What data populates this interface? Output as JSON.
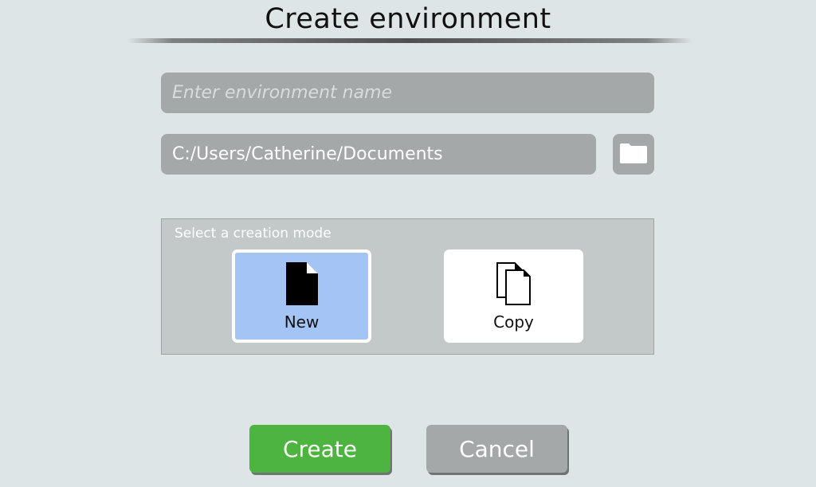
{
  "dialog": {
    "title": "Create environment"
  },
  "name_field": {
    "value": "",
    "placeholder": "Enter environment name"
  },
  "path_field": {
    "value": "C:/Users/Catherine/Documents",
    "placeholder": ""
  },
  "browse": {
    "icon": "folder-icon"
  },
  "creation_mode": {
    "label": "Select a creation mode",
    "selected": "New",
    "options": [
      {
        "label": "New",
        "icon": "new-document-icon",
        "selected": true
      },
      {
        "label": "Copy",
        "icon": "copy-documents-icon",
        "selected": false
      }
    ]
  },
  "actions": {
    "create_label": "Create",
    "cancel_label": "Cancel"
  },
  "colors": {
    "background": "#dde5e6",
    "field": "#a4a8a8",
    "selected_mode": "#a3c4f5",
    "create": "#4db43f",
    "cancel": "#a4a8a8"
  }
}
